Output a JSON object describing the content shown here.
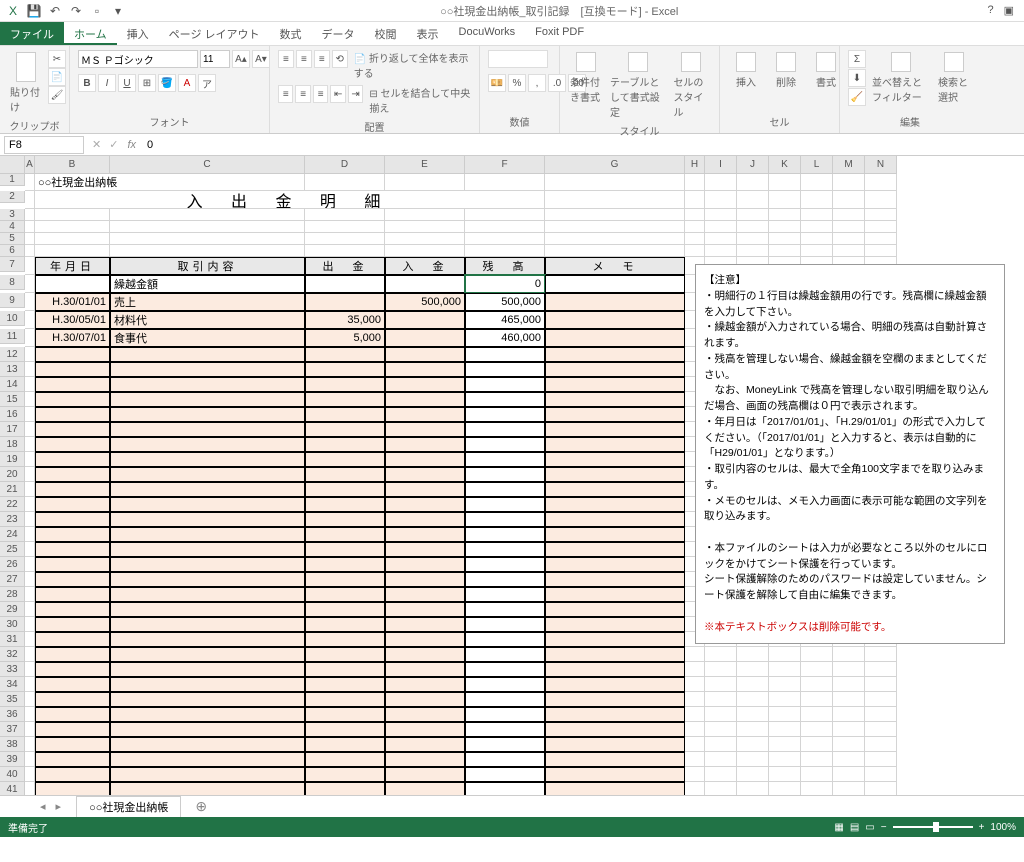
{
  "title": "○○社現金出納帳_取引記録　[互換モード] - Excel",
  "qat": {
    "save": "💾",
    "undo": "↶",
    "redo": "↷",
    "new": "▫"
  },
  "tabs": {
    "file": "ファイル",
    "home": "ホーム",
    "insert": "挿入",
    "layout": "ページ レイアウト",
    "formula": "数式",
    "data": "データ",
    "review": "校閲",
    "view": "表示",
    "docuworks": "DocuWorks",
    "foxit": "Foxit PDF"
  },
  "ribbon": {
    "clipboard": {
      "label": "クリップボード",
      "paste": "貼り付け"
    },
    "font": {
      "label": "フォント",
      "name": "ＭＳ Ｐゴシック",
      "size": "11"
    },
    "align": {
      "label": "配置",
      "wrap": "折り返して全体を表示する",
      "merge": "セルを結合して中央揃え"
    },
    "number": {
      "label": "数値"
    },
    "style": {
      "label": "スタイル",
      "cond": "条件付き書式",
      "table": "テーブルとして書式設定",
      "cell": "セルのスタイル"
    },
    "cells": {
      "label": "セル",
      "insert": "挿入",
      "delete": "削除",
      "format": "書式"
    },
    "edit": {
      "label": "編集",
      "sort": "並べ替えとフィルター",
      "find": "検索と選択"
    }
  },
  "namebox": "F8",
  "formula": "0",
  "cols": [
    "A",
    "B",
    "C",
    "D",
    "E",
    "F",
    "G",
    "H",
    "I",
    "J",
    "K",
    "L",
    "M",
    "N"
  ],
  "sheet": {
    "doctitle": "○○社現金出納帳",
    "heading": "入 出 金 明 細",
    "headers": {
      "date": "年月日",
      "desc": "取引内容",
      "out": "出　金",
      "in": "入　金",
      "bal": "残　高",
      "memo": "メ　モ"
    },
    "rows": [
      {
        "date": "",
        "desc": "繰越金額",
        "out": "",
        "in": "",
        "bal": "0",
        "memo": ""
      },
      {
        "date": "H.30/01/01",
        "desc": "売上",
        "out": "",
        "in": "500,000",
        "bal": "500,000",
        "memo": ""
      },
      {
        "date": "H.30/05/01",
        "desc": "材料代",
        "out": "35,000",
        "in": "",
        "bal": "465,000",
        "memo": ""
      },
      {
        "date": "H.30/07/01",
        "desc": "食事代",
        "out": "5,000",
        "in": "",
        "bal": "460,000",
        "memo": ""
      }
    ]
  },
  "notes": {
    "t": "【注意】",
    "l1": "・明細行の１行目は繰越金額用の行です。残高欄に繰越金額を入力して下さい。",
    "l2": "・繰越金額が入力されている場合、明細の残高は自動計算されます。",
    "l3": "・残高を管理しない場合、繰越金額を空欄のままとしてください。",
    "l4": "　なお、MoneyLink で残高を管理しない取引明細を取り込んだ場合、画面の残高欄は０円で表示されます。",
    "l5": "・年月日は「2017/01/01」、「H.29/01/01」の形式で入力してください。（「2017/01/01」と入力すると、表示は自動的に「H29/01/01」となります。）",
    "l6": "・取引内容のセルは、最大で全角100文字までを取り込みます。",
    "l7": "・メモのセルは、メモ入力画面に表示可能な範囲の文字列を取り込みます。",
    "l8": "・本ファイルのシートは入力が必要なところ以外のセルにロックをかけてシート保護を行っています。",
    "l9": "シート保護解除のためのパスワードは設定していません。シート保護を解除して自由に編集できます。",
    "l10": "※本テキストボックスは削除可能です。"
  },
  "sheettab": "○○社現金出納帳",
  "status": "準備完了",
  "zoom": "100%"
}
